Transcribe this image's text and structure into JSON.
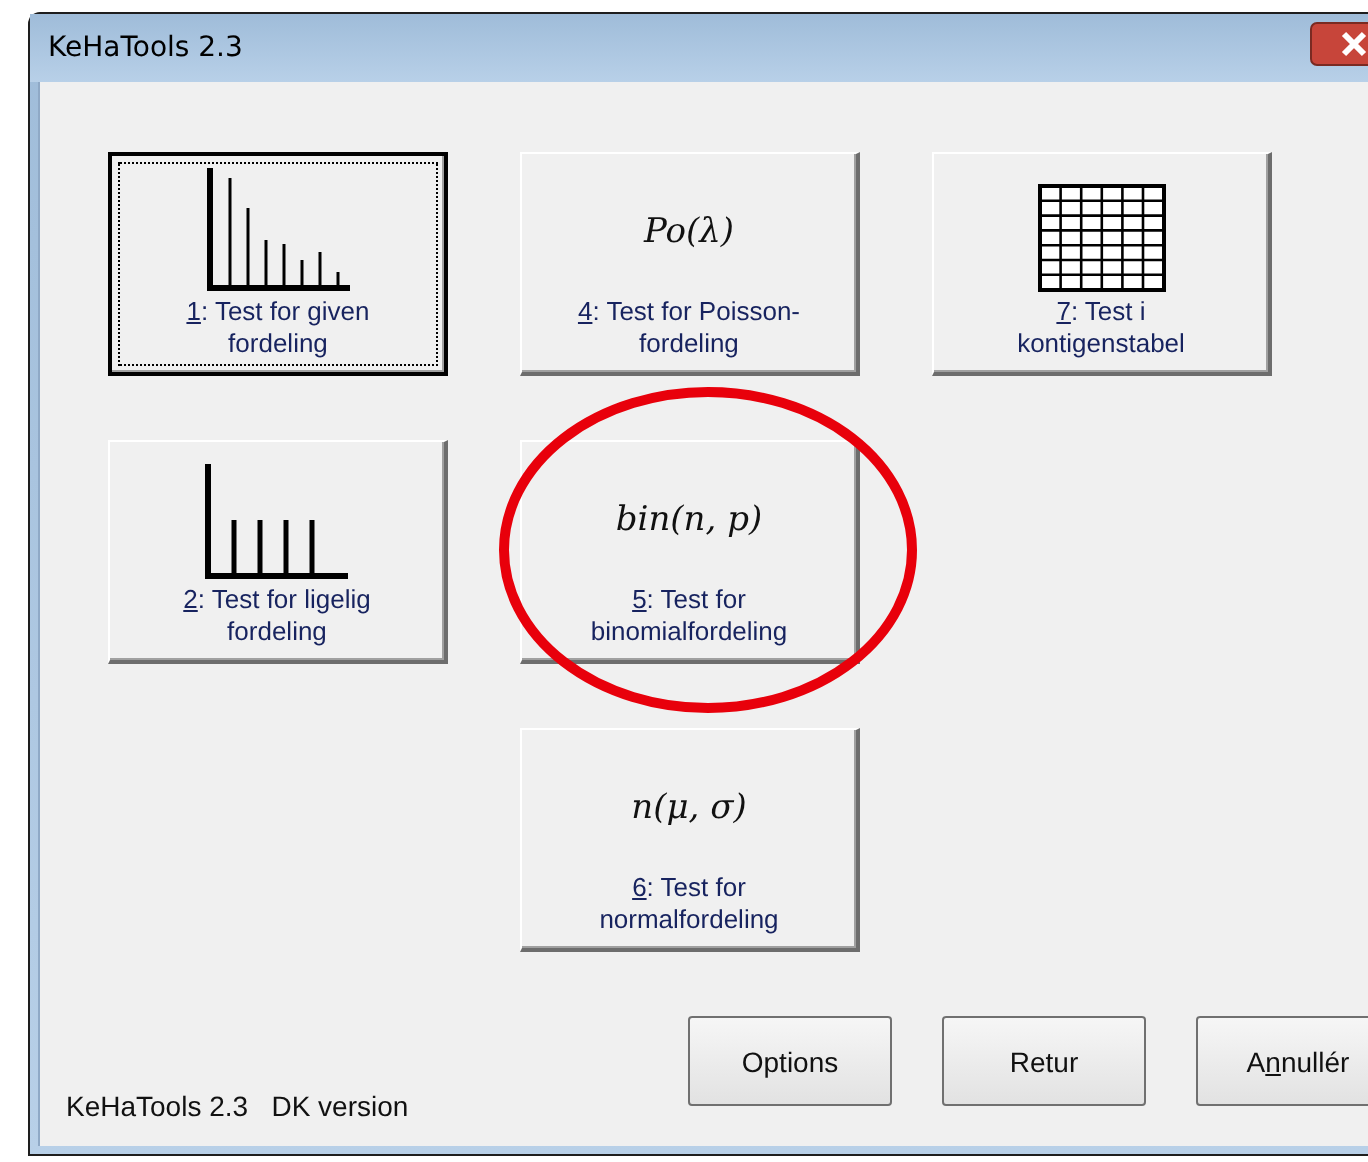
{
  "window": {
    "title": "KeHaTools 2.3"
  },
  "columns": [
    [
      {
        "kind": "decay-bars",
        "mnemonic": "1",
        "line1": ": Test for given",
        "line2": "fordeling",
        "focused": true,
        "highlighted": false
      },
      {
        "kind": "uniform-bars",
        "mnemonic": "2",
        "line1": ": Test for ligelig",
        "line2": "fordeling",
        "focused": false,
        "highlighted": false
      }
    ],
    [
      {
        "kind": "formula",
        "formula": "Po(λ)",
        "mnemonic": "4",
        "line1": ": Test for Poisson-",
        "line2": "fordeling",
        "focused": false,
        "highlighted": false
      },
      {
        "kind": "formula",
        "formula": "bin(n, p)",
        "mnemonic": "5",
        "line1": ": Test for",
        "line2": "binomialfordeling",
        "focused": false,
        "highlighted": true
      },
      {
        "kind": "formula",
        "formula": "n(μ, σ)",
        "mnemonic": "6",
        "line1": ": Test for",
        "line2": "normalfordeling",
        "focused": false,
        "highlighted": false
      }
    ],
    [
      {
        "kind": "grid",
        "mnemonic": "7",
        "line1": ": Test i",
        "line2": "kontigenstabel",
        "focused": false,
        "highlighted": false
      }
    ]
  ],
  "version": "KeHaTools 2.3   DK version",
  "buttons": [
    {
      "before": "Options"
    },
    {
      "before": "Retur"
    },
    {
      "before": "A",
      "mnemonic": "n",
      "after": "nullér"
    }
  ]
}
